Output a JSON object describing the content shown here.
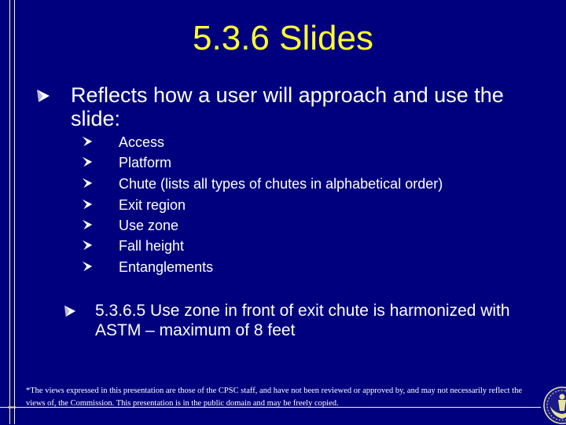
{
  "slide": {
    "title": "5.3.6 Slides",
    "bullet": "Reflects how a user will approach and use the slide:",
    "sub_bullets": [
      "Access",
      "Platform",
      "Chute (lists all types of chutes in alphabetical order)",
      "Exit region",
      "Use zone",
      "Fall height",
      "Entanglements"
    ],
    "second_bullet": "5.3.6.5 Use zone in front of exit chute is harmonized with ASTM – maximum of 8 feet",
    "disclaimer": "*The views expressed in this presentation are those of the CPSC staff, and have not been reviewed or approved by, and may not necessarily reflect the views of, the Commission.  This presentation is in the public domain and may be freely copied.",
    "bullet_icon": "arrowhead-bullet-icon",
    "logo_icon": "cpsc-seal-icon"
  },
  "colors": {
    "background": "#00007e",
    "title": "#ffff33",
    "text": "#ffffff",
    "seal": "#e8e4a0"
  }
}
